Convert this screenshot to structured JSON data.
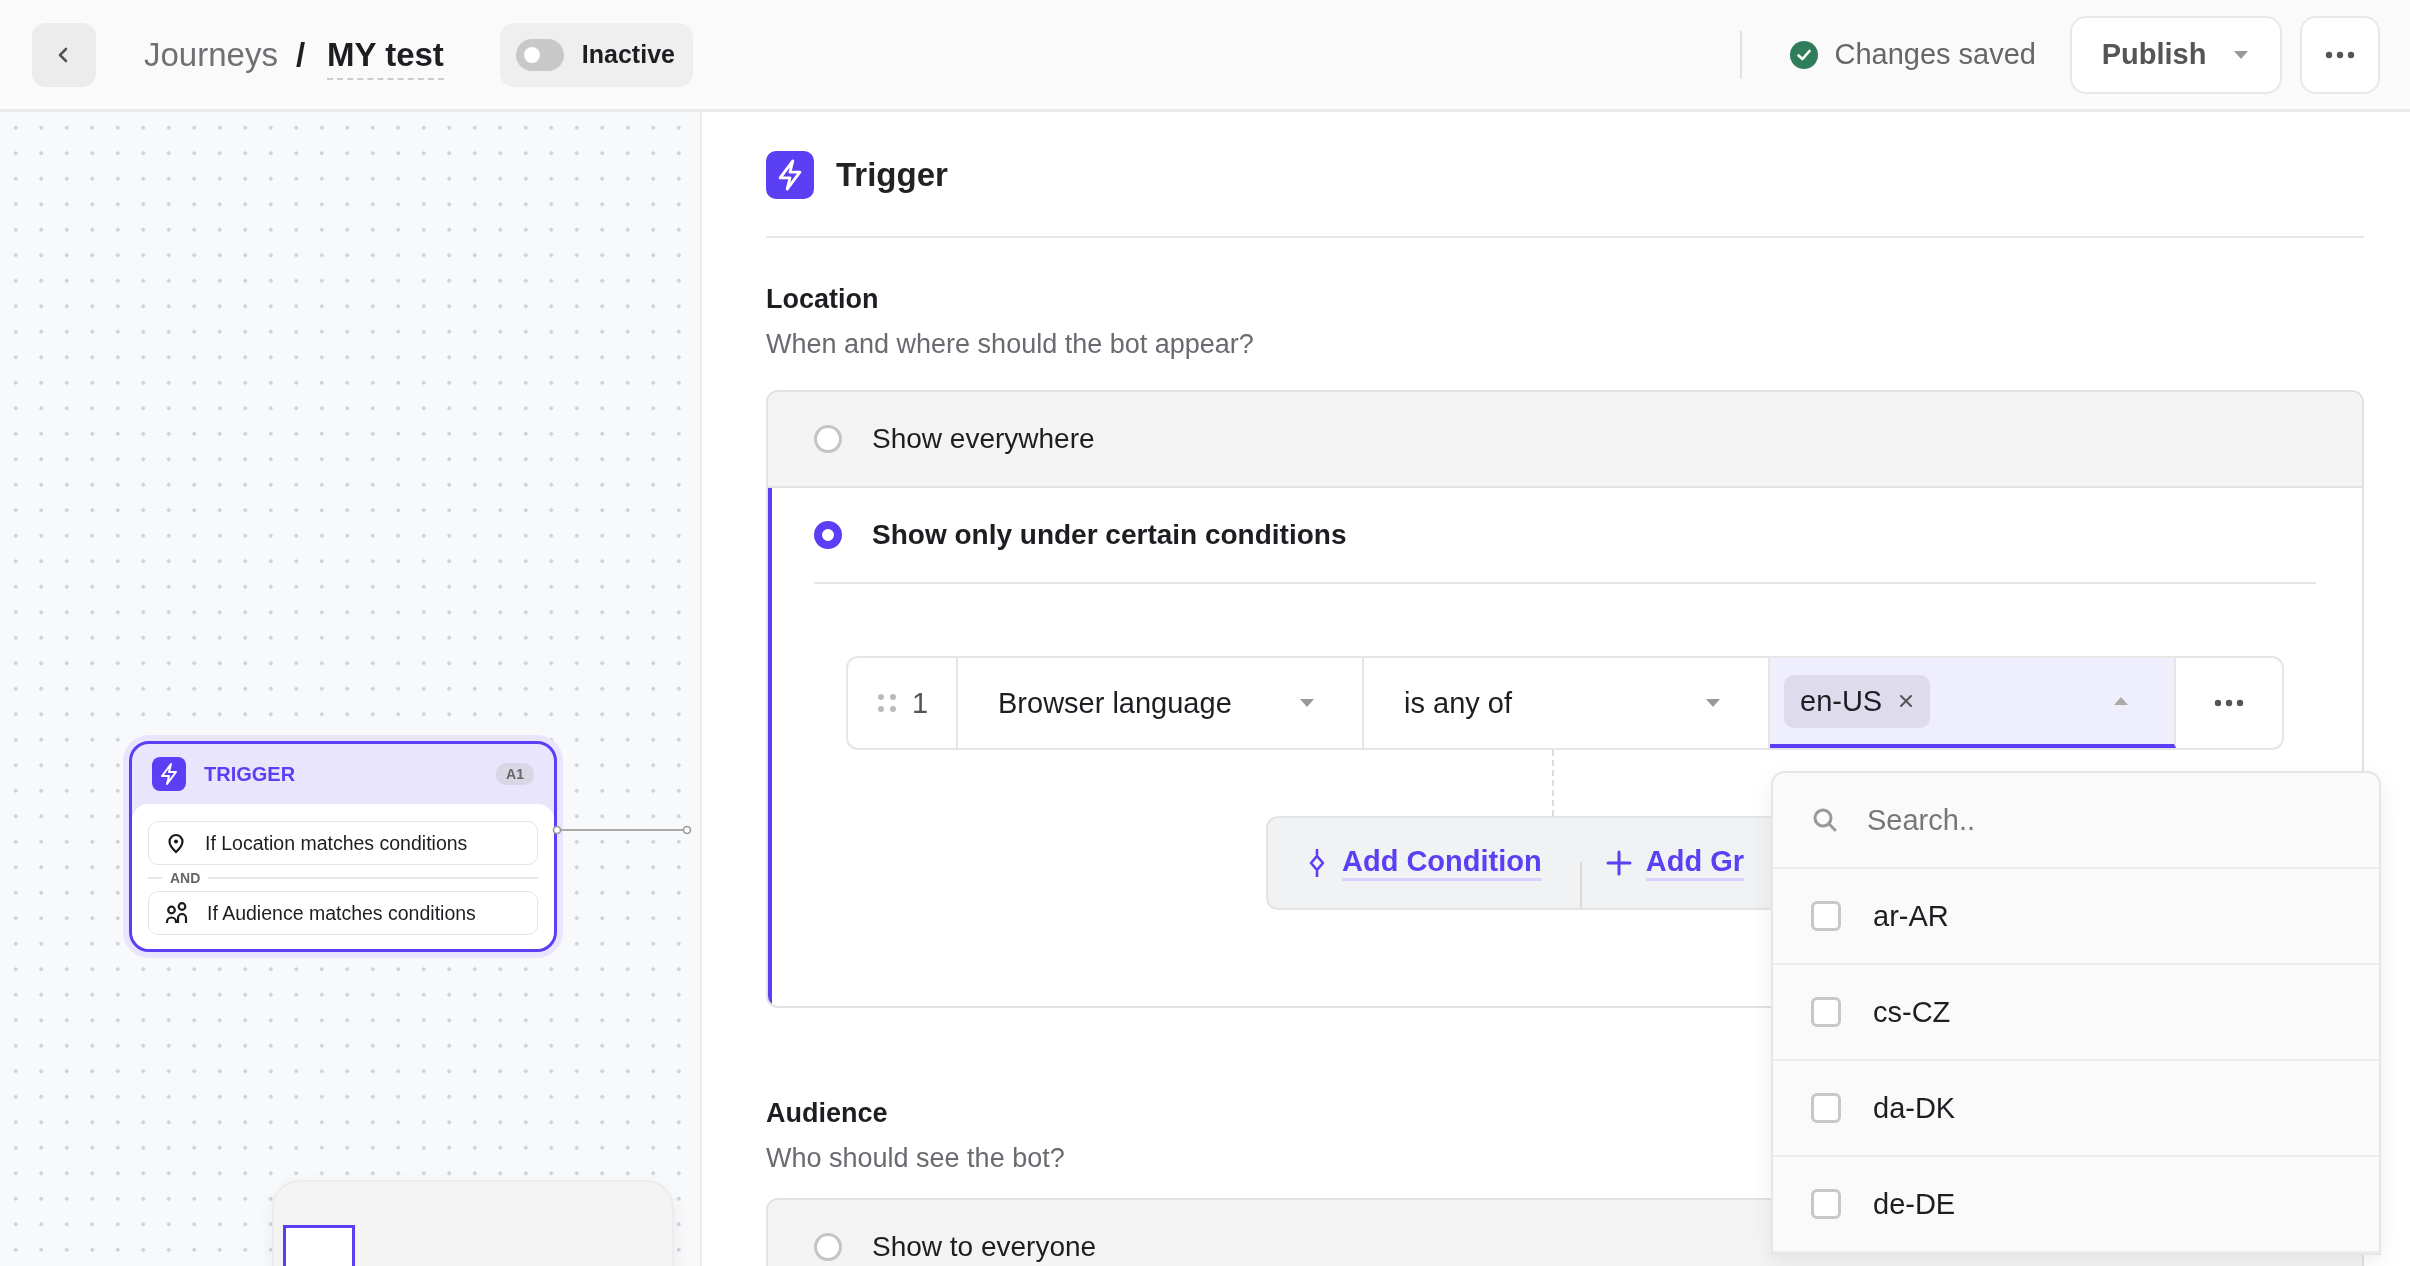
{
  "topbar": {
    "breadcrumb": [
      "Journeys",
      "MY test"
    ],
    "separator": "/",
    "status_toggle": {
      "label": "Inactive",
      "on": false
    },
    "save_status": "Changes saved",
    "publish_button": "Publish"
  },
  "canvas": {
    "trigger_node": {
      "title": "TRIGGER",
      "badge": "A1",
      "joiner": "AND",
      "conditions": [
        {
          "kind": "location",
          "label": "If Location matches conditions"
        },
        {
          "kind": "audience",
          "label": "If Audience matches conditions"
        }
      ]
    }
  },
  "panel": {
    "title": "Trigger",
    "location": {
      "title": "Location",
      "subtitle": "When and where should the bot appear?",
      "options": [
        {
          "label": "Show everywhere",
          "selected": false
        },
        {
          "label": "Show only under certain conditions",
          "selected": true
        }
      ],
      "condition": {
        "index": "1",
        "field": "Browser language",
        "operator": "is any of",
        "values": [
          "en-US"
        ],
        "open": true
      },
      "actions": [
        {
          "kind": "condition",
          "label": "Add Condition"
        },
        {
          "kind": "group",
          "label": "Add Gr"
        }
      ]
    },
    "audience": {
      "title": "Audience",
      "subtitle": "Who should see the bot?",
      "options": [
        {
          "label": "Show to everyone",
          "selected": false
        }
      ]
    },
    "dropdown": {
      "placeholder": "Search..",
      "options": [
        {
          "label": "ar-AR",
          "checked": false
        },
        {
          "label": "cs-CZ",
          "checked": false
        },
        {
          "label": "da-DK",
          "checked": false
        },
        {
          "label": "de-DE",
          "checked": false
        }
      ]
    }
  }
}
